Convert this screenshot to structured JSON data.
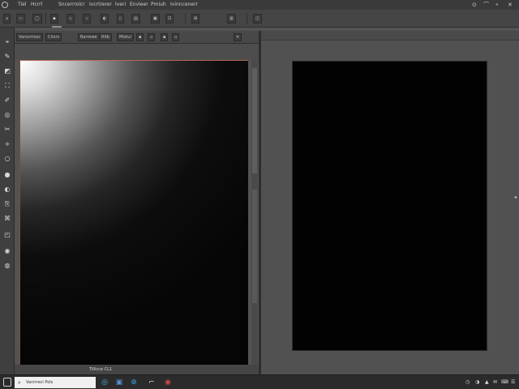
{
  "menubar": {
    "items": [
      "Tiel",
      "Hcrrl",
      "Sncerrrolcr",
      "Ivcrtrerer",
      "Iveri",
      "Envieer",
      "Pmiuh",
      "Ivinncenerr"
    ],
    "window_controls": [
      "⊙",
      "⌒",
      "⚬",
      "✕"
    ]
  },
  "optionbar": {
    "buttons": [
      "⌂",
      "▭",
      "◯",
      "◆",
      "◇",
      "♨",
      "◐",
      "▯",
      "▤",
      "▣",
      "⊡",
      "⊞",
      "▥",
      "◫"
    ]
  },
  "tools": [
    "⌖",
    "✎",
    "◩",
    "⛶",
    "✐",
    "◎",
    "✂",
    "⟡",
    "○",
    "●",
    "◐",
    "⎘",
    "⌘",
    "◰",
    "◉",
    "◍"
  ],
  "document": {
    "tabs": [
      "Vanorrrooc",
      "Cirsrs",
      "Barrowe",
      "Ritb",
      "Mistul"
    ],
    "tab_close": [
      "▪",
      "▫",
      "▪",
      "▫",
      "✕"
    ]
  },
  "statusbar": {
    "doc_info": "Tillicce CL1"
  },
  "right_panel": {
    "side_arrow": "◂"
  },
  "taskbar": {
    "search_placeholder": "Vanirrecl Pols",
    "apps": [
      "◎",
      "▣",
      "⊕",
      "⌐",
      "◉"
    ],
    "tray": [
      "◷",
      "◑",
      "▲",
      "✉",
      "⌨",
      "☰"
    ]
  }
}
